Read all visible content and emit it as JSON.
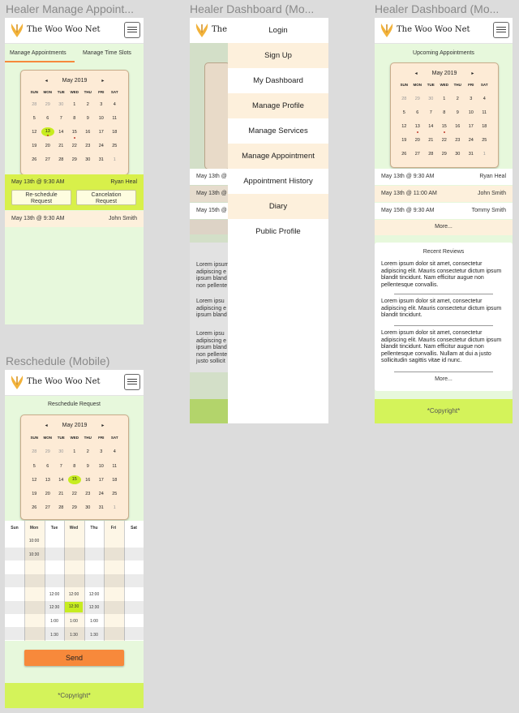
{
  "brand": {
    "name": "The Woo Woo Net"
  },
  "frames": {
    "manage": {
      "title": "Healer Manage Appoint..."
    },
    "dash_menu": {
      "title": "Healer Dashboard (Mo..."
    },
    "dash": {
      "title": "Healer Dashboard (Mo..."
    },
    "reschedule": {
      "title": "Reschedule (Mobile)"
    }
  },
  "calendar": {
    "month": "May 2019",
    "prev": "◂",
    "next": "▸",
    "dow": [
      "SUN",
      "MON",
      "TUE",
      "WED",
      "THU",
      "FRI",
      "SAT"
    ],
    "weeks": [
      [
        "28",
        "29",
        "30",
        "1",
        "2",
        "3",
        "4"
      ],
      [
        "5",
        "6",
        "7",
        "8",
        "9",
        "10",
        "11"
      ],
      [
        "12",
        "13",
        "14",
        "15",
        "16",
        "17",
        "18"
      ],
      [
        "19",
        "20",
        "21",
        "22",
        "23",
        "24",
        "25"
      ],
      [
        "26",
        "27",
        "28",
        "29",
        "30",
        "31",
        "1"
      ]
    ]
  },
  "manage": {
    "tabs": {
      "appointments": "Manage Appointments",
      "timeslots": "Manage Time Slots"
    },
    "appt1": {
      "when": "May 13th @ 9:30 AM",
      "who": "Ryan Heal"
    },
    "reschedule_btn": "Re-schedule\nRequest",
    "cancel_btn": "Cancelation\nRequest",
    "appt2": {
      "when": "May 13th @ 9:30 AM",
      "who": "John Smith"
    }
  },
  "menu": {
    "items": [
      "Login",
      "Sign Up",
      "My Dashboard",
      "Manage Profile",
      "Manage Services",
      "Manage Appointment",
      "Appointment History",
      "Diary",
      "Public Profile"
    ],
    "behind": {
      "a1": "May 13th @",
      "a2": "May 13th @",
      "a3": "May 15th @",
      "t1": "Lorem ipsum\nadipiscing e\nipsum bland\nnon pellente",
      "t2": "Lorem ipsu\nadipiscing e\nipsum bland",
      "t3": "Lorem ipsu\nadipiscing e\nipsum bland\nnon pellente\njusto sollicit"
    }
  },
  "dashboard": {
    "upcoming": "Upcoming Appointments",
    "appointments": [
      {
        "when": "May 13th @ 9:30 AM",
        "who": "Ryan Heal"
      },
      {
        "when": "May 13th @ 11:00 AM",
        "who": "John Smith"
      },
      {
        "when": "May 15th @ 9:30 AM",
        "who": "Tommy Smith"
      }
    ],
    "more": "More...",
    "reviews_title": "Recent Reviews",
    "reviews": [
      "Lorem ipsum dolor sit amet, consectetur adipiscing elit. Mauris consectetur dictum ipsum blandit tincidunt. Nam efficitur augue non pellentesque convallis.",
      "Lorem ipsum dolor sit amet, consectetur adipiscing elit. Mauris consectetur dictum ipsum blandit tincidunt.",
      "Lorem ipsum dolor sit amet, consectetur adipiscing elit. Mauris consectetur dictum ipsum blandit tincidunt. Nam efficitur augue non pellentesque convallis. Nullam at dui a justo sollicitudin sagittis vitae id nunc."
    ],
    "reviews_more": "More...",
    "copyright": "*Copyright*"
  },
  "reschedule": {
    "heading": "Reschedule Request",
    "days": [
      "Sun",
      "Mon",
      "Tue",
      "Wed",
      "Thu",
      "Fri",
      "Sat"
    ],
    "mon_times": [
      "10:00",
      "10:30"
    ],
    "grid_times": [
      [
        "12:00",
        "12:00",
        "12:00"
      ],
      [
        "12:30",
        "12:30",
        "12:30"
      ],
      [
        "1:00",
        "1:00",
        "1:00"
      ],
      [
        "1:30",
        "1:30",
        "1:30"
      ]
    ],
    "send": "Send",
    "copyright": "*Copyright*"
  },
  "colors": {
    "lime": "#c7ec20",
    "green_bg": "#e7f8dc",
    "peach": "#fdebd6",
    "orange": "#f7893b"
  }
}
